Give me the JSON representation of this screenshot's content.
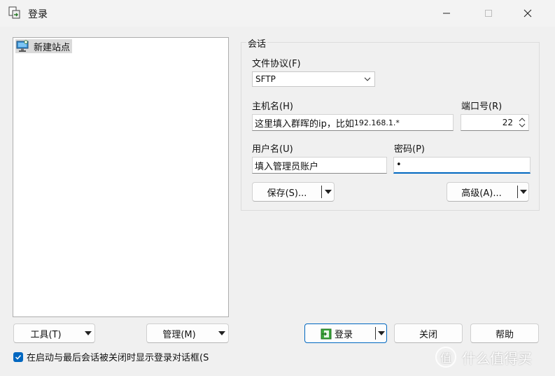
{
  "window": {
    "title": "登录"
  },
  "tree": {
    "items": [
      {
        "label": "新建站点"
      }
    ]
  },
  "session": {
    "group_title": "会话",
    "protocol_label": "文件协议(F)",
    "protocol_value": "SFTP",
    "host_label": "主机名(H)",
    "host_value_text": "这里填入群晖的ip，比如",
    "host_value_ip": "192.168.1.*",
    "port_label": "端口号(R)",
    "port_value": "22",
    "user_label": "用户名(U)",
    "user_value": "填入管理员账户",
    "password_label": "密码(P)",
    "password_value": "•",
    "save_button": "保存(S)...",
    "advanced_button": "高级(A)..."
  },
  "bottom": {
    "tools_button": "工具(T)",
    "manage_button": "管理(M)",
    "login_button": "登录",
    "close_button": "关闭",
    "help_button": "帮助",
    "checkbox_label": "在启动与最后会话被关闭时显示登录对话框(S"
  },
  "watermark": {
    "symbol": "值",
    "text": "什么值得买"
  },
  "colors": {
    "accent": "#0067c0",
    "background": "#f0f0f0"
  }
}
